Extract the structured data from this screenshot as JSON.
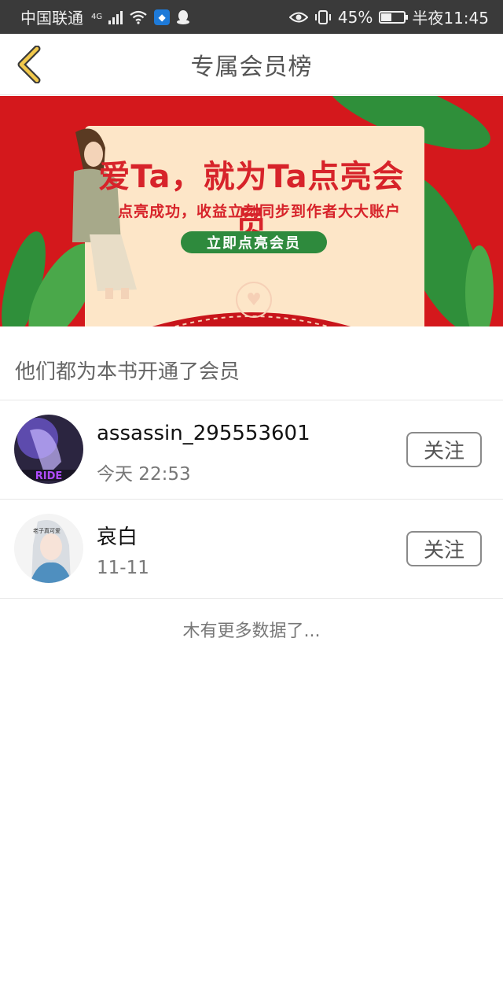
{
  "status_bar": {
    "carrier": "中国联通",
    "network": "4G",
    "battery": "45%",
    "battery_level": 0.45,
    "time": "半夜11:45"
  },
  "header": {
    "title": "专属会员榜",
    "back_icon": "chevron-left-icon"
  },
  "banner": {
    "headline": "爱Ta，就为Ta点亮会员",
    "subtitle": "点亮成功，收益立刻同步到作者大大账户",
    "cta": "立即点亮会员",
    "colors": {
      "background": "#d4181c",
      "card": "#fde6c8",
      "cta": "#2e8a3d"
    }
  },
  "section": {
    "title": "他们都为本书开通了会员"
  },
  "members": [
    {
      "name": "assassin_295553601",
      "time": "今天 22:53",
      "follow_label": "关注",
      "avatar_label": "RIDE"
    },
    {
      "name": "哀白",
      "time": "11-11",
      "follow_label": "关注",
      "avatar_label": "老子真可爱"
    }
  ],
  "footer": {
    "no_more": "木有更多数据了..."
  }
}
